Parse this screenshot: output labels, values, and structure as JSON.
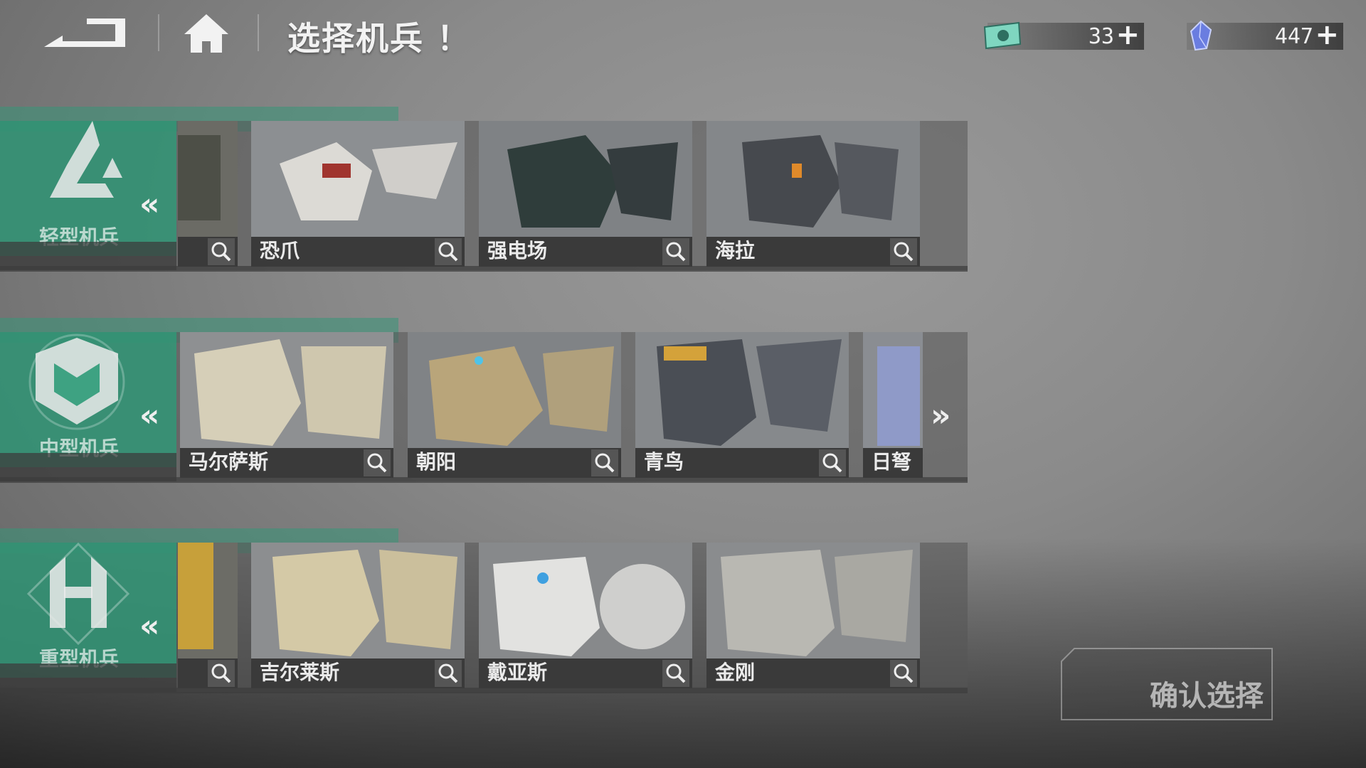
{
  "header": {
    "title": "选择机兵 ！"
  },
  "currency": [
    {
      "icon": "ticket-icon",
      "value": "33",
      "plus": "+"
    },
    {
      "icon": "crystal-icon",
      "value": "447",
      "plus": "+"
    }
  ],
  "categories": [
    {
      "label": "轻型机兵",
      "emblem": "light-mech-emblem",
      "mechs": [
        "恐爪",
        "强电场",
        "海拉"
      ]
    },
    {
      "label": "中型机兵",
      "emblem": "medium-mech-emblem",
      "mechs": [
        "马尔萨斯",
        "朝阳",
        "青鸟",
        "日弩"
      ]
    },
    {
      "label": "重型机兵",
      "emblem": "heavy-mech-emblem",
      "mechs": [
        "吉尔莱斯",
        "戴亚斯",
        "金刚"
      ]
    }
  ],
  "nav": {
    "left_arrow": "«",
    "right_arrow": "»"
  },
  "confirm": {
    "label": "确认选择"
  },
  "colors": {
    "accent_green": "#37967a",
    "panel_dark": "#3a3a3a"
  }
}
